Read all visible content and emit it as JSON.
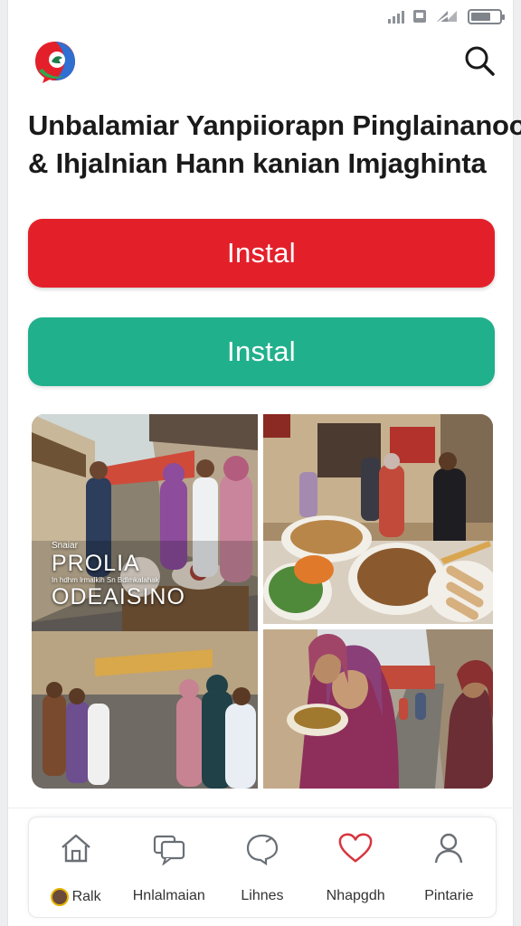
{
  "status_bar": {
    "icons": [
      "signal-icon",
      "sim-icon",
      "wifi-icon",
      "battery-icon"
    ],
    "battery_level": 0.7
  },
  "header": {
    "logo": "app-logo-icon",
    "search_icon": "search-icon",
    "title_line1": "Unbalamiar Yanpiiorapn Pinglainanoo",
    "title_line2": "& Ihjalnian Hann kanian Imjaghinta"
  },
  "actions": {
    "install_primary_label": "Instal",
    "install_secondary_label": "Instal"
  },
  "gallery": {
    "photo1_caption_small": "Snaiar",
    "photo1_caption_big_line1": "PROLIA",
    "photo1_caption_mid": "In hdhm lrmalkih Sn Bdlmkalahak",
    "photo1_caption_big_line2": "ODEAISINO"
  },
  "bottom_nav": {
    "items": [
      {
        "label": "Ralk",
        "icon": "home-icon"
      },
      {
        "label": "Hnlalmaian",
        "icon": "chat-icon"
      },
      {
        "label": "Lihnes",
        "icon": "speech-bubble-icon"
      },
      {
        "label": "Nhapgdh",
        "icon": "heart-icon"
      },
      {
        "label": "Pintarie",
        "icon": "profile-icon"
      }
    ]
  },
  "colors": {
    "install_primary": "#e3202a",
    "install_secondary": "#21b08c",
    "text": "#1a1a1a"
  }
}
